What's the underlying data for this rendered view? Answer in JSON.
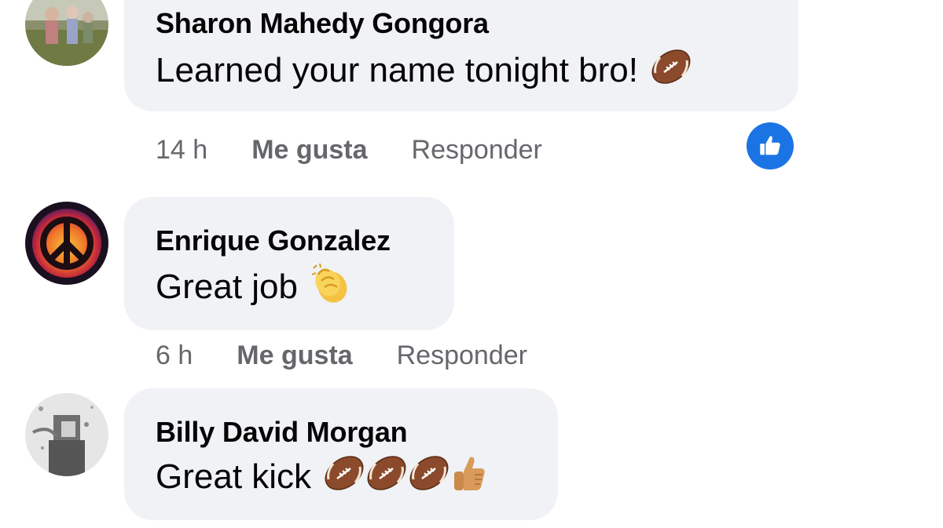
{
  "comments": [
    {
      "author": "Sharon Mahedy Gongora",
      "text": "Learned your name tonight bro!",
      "emojis": [
        "football-emoji"
      ],
      "time": "14 h",
      "like_label": "Me gusta",
      "reply_label": "Responder",
      "reaction": "like-icon"
    },
    {
      "author": "Enrique Gonzalez",
      "text": "Great job",
      "emojis": [
        "clapping-hands-emoji"
      ],
      "time": "6 h",
      "like_label": "Me gusta",
      "reply_label": "Responder"
    },
    {
      "author": "Billy David Morgan",
      "text": "Great kick",
      "emojis": [
        "football-emoji",
        "football-emoji",
        "football-emoji",
        "thumbs-up-emoji"
      ]
    }
  ],
  "colors": {
    "bubble": "#f0f2f5",
    "meta_text": "#65676b",
    "reaction_blue": "#1b74e4"
  }
}
